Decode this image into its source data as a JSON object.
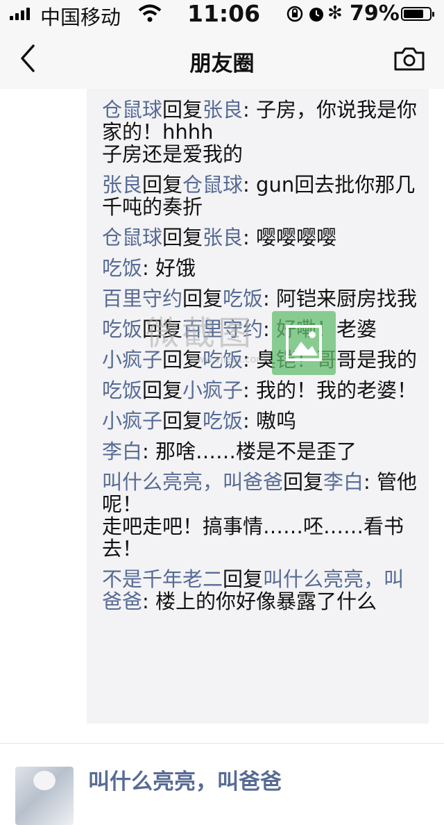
{
  "status_bar": {
    "carrier": "中国移动",
    "time": "11:06",
    "battery_percent": "79%",
    "battery_level": 0.79,
    "bluetooth_glyph": "✻"
  },
  "nav": {
    "title": "朋友圈",
    "back_icon": "chevron-left-icon",
    "camera_icon": "camera-icon"
  },
  "comments": {
    "reply_word": "回复",
    "colon": ": ",
    "top_clip": "…",
    "items": [
      {
        "from": "仓鼠球",
        "to": "张良",
        "text": "子房，你说我是你家的！hhhh\n子房还是爱我的"
      },
      {
        "from": "张良",
        "to": "仓鼠球",
        "text": "gun回去批你那几千吨的奏折"
      },
      {
        "from": "仓鼠球",
        "to": "张良",
        "text": "嘤嘤嘤嘤"
      },
      {
        "from": "吃饭",
        "to": "",
        "text": "好饿"
      },
      {
        "from": "百里守约",
        "to": "吃饭",
        "text": "阿铠来厨房找我"
      },
      {
        "from": "吃饭",
        "to": "百里守约",
        "text": "好嘞！老婆"
      },
      {
        "from": "小疯子",
        "to": "吃饭",
        "text": "臭铠！哥哥是我的"
      },
      {
        "from": "吃饭",
        "to": "小疯子",
        "text": "我的！我的老婆！"
      },
      {
        "from": "小疯子",
        "to": "吃饭",
        "text": "嗷呜"
      },
      {
        "from": "李白",
        "to": "",
        "text": "那啥……楼是不是歪了"
      },
      {
        "from": "叫什么亮亮，叫爸爸",
        "to": "李白",
        "text": "管他呢！\n走吧走吧！搞事情……呸……看书去！"
      },
      {
        "from": "不是千年老二",
        "to": "叫什么亮亮，叫爸爸",
        "text": "楼上的你好像暴露了什么"
      }
    ]
  },
  "watermark": {
    "text": "微截图",
    "url": "www.vjietu.com"
  },
  "next_post": {
    "author": "叫什么亮亮，叫爸爸",
    "avatar_icon": "avatar"
  },
  "colors": {
    "name_link": "#576b95",
    "comment_bg": "#f3f3f5",
    "bar_bg": "#f7f7f7"
  }
}
